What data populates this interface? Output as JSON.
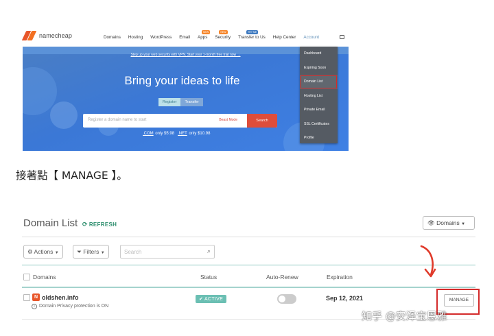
{
  "namecheap": {
    "logo_text": "namecheap",
    "menu": [
      "Domains",
      "Hosting",
      "WordPress",
      "Email",
      "Apps",
      "Security",
      "Transfer to Us",
      "Help Center",
      "Account"
    ],
    "badges": {
      "apps": "NEW",
      "security": "NEW",
      "transfer": "TRY ME"
    },
    "promo_strip": "Step up your web security with VPN. Start your 1-month free trial now →",
    "hero_title": "Bring your ideas to life",
    "tabs": [
      "Register",
      "Transfer"
    ],
    "search_placeholder": "Register a domain name to start",
    "beast_mode": "Beast Mode",
    "search_button": "Search",
    "price_com_tld": ".COM",
    "price_com_text": "only $5.98",
    "price_net_tld": ".NET",
    "price_net_text": "only $10.98",
    "account_menu": [
      "Dashboard",
      "Expiring Soon",
      "Domain List",
      "Hosting List",
      "Private Email",
      "SSL Certificates",
      "Profile"
    ],
    "highlighted_item": "Domain List"
  },
  "caption": "接著點【 MANAGE 】。",
  "domain_list": {
    "title": "Domain List",
    "refresh": "REFRESH",
    "view_select": "Domains",
    "actions": "Actions",
    "filters": "Filters",
    "search_placeholder": "Search",
    "columns": [
      "Domains",
      "Status",
      "Auto-Renew",
      "Expiration"
    ],
    "row": {
      "domain": "oldshen.info",
      "privacy": "Domain Privacy protection is ON",
      "status": "ACTIVE",
      "auto_renew": false,
      "expiration": "Sep 12, 2021",
      "manage": "MANAGE"
    }
  },
  "watermark": "知乎 @安泽宝恩雅",
  "colors": {
    "accent_red": "#d42a2a",
    "namecheap_orange": "#e8562a",
    "hero_blue": "#3b78d6",
    "status_teal": "#6bbfb3"
  }
}
